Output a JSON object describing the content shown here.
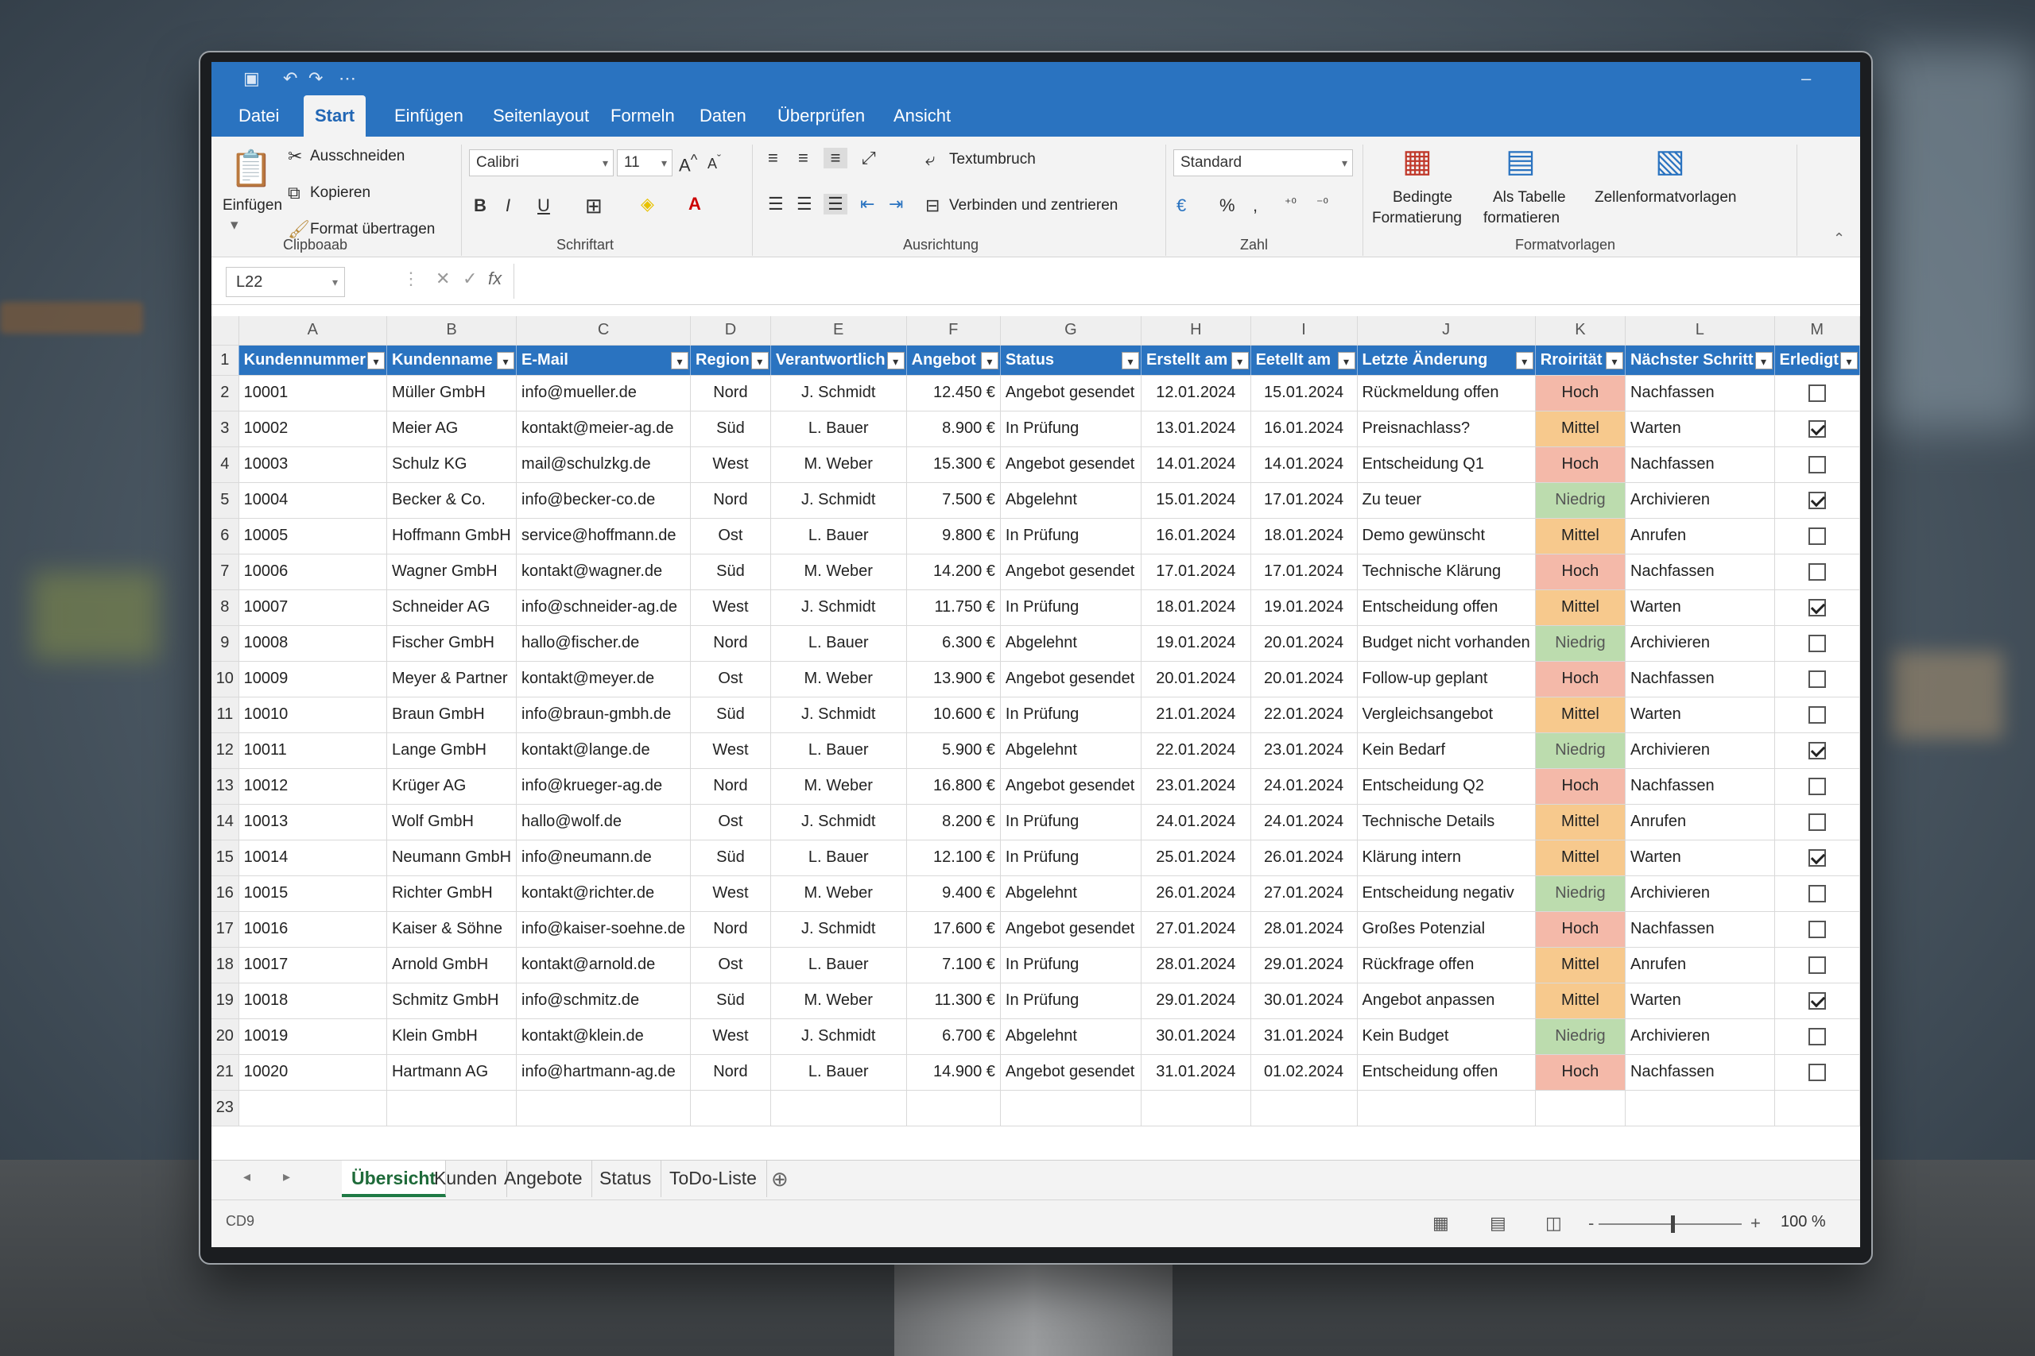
{
  "ribbon": {
    "tabs": [
      "Datei",
      "Start",
      "Einfügen",
      "Seitenlayout",
      "Formeln",
      "Daten",
      "Überprüfen",
      "Ansicht"
    ],
    "clipboard": {
      "paste": "Einfügen",
      "cut": "Ausschneiden",
      "copy": "Kopieren",
      "format_painter": "Format übertragen",
      "group": "Clipboaab"
    },
    "font": {
      "name": "Calibri",
      "size": "11",
      "group": "Schriftart",
      "bold": "B",
      "italic": "I",
      "underline": "U"
    },
    "alignment": {
      "wrap": "Textumbruch",
      "merge": "Verbinden und zentrieren",
      "group": "Ausrichtung"
    },
    "number": {
      "format": "Standard",
      "percent": "%",
      "group": "Zahl"
    },
    "styles": {
      "conditional_1": "Bedingte",
      "conditional_2": "Formatierung",
      "table_1": "Als Tabelle",
      "table_2": "formatieren",
      "cell_styles": "Zellenformatvorlagen",
      "group": "Formatvorlagen"
    }
  },
  "formula_bar": {
    "name_box": "L22",
    "fx": "fx",
    "value": ""
  },
  "columns": [
    "A",
    "B",
    "C",
    "D",
    "E",
    "F",
    "G",
    "H",
    "I",
    "J",
    "K",
    "L",
    "M"
  ],
  "headers": [
    "Kundennummer",
    "Kundenname",
    "E-Mail",
    "Region",
    "Verantwortlich",
    "Angebot",
    "Status",
    "Erstellt am",
    "Eetellt am",
    "Letzte Änderung",
    "Rroirität",
    "Nächster Schritt",
    "Erledigt"
  ],
  "rows": [
    {
      "n": "2",
      "id": "10001",
      "name": "Müller GmbH",
      "mail": "info@mueller.de",
      "region": "Nord",
      "owner": "J. Schmidt",
      "offer": "12.450 €",
      "status": "Angebot gesendet",
      "created": "12.01.2024",
      "edited": "15.01.2024",
      "change": "Rückmeldung offen",
      "prio": "Hoch",
      "next": "Nachfassen",
      "done": false
    },
    {
      "n": "3",
      "id": "10002",
      "name": "Meier AG",
      "mail": "kontakt@meier-ag.de",
      "region": "Süd",
      "owner": "L. Bauer",
      "offer": "8.900 €",
      "status": "In Prüfung",
      "created": "13.01.2024",
      "edited": "16.01.2024",
      "change": "Preisnachlass?",
      "prio": "Mittel",
      "next": "Warten",
      "done": true
    },
    {
      "n": "4",
      "id": "10003",
      "name": "Schulz KG",
      "mail": "mail@schulzkg.de",
      "region": "West",
      "owner": "M. Weber",
      "offer": "15.300 €",
      "status": "Angebot gesendet",
      "created": "14.01.2024",
      "edited": "14.01.2024",
      "change": "Entscheidung Q1",
      "prio": "Hoch",
      "next": "Nachfassen",
      "done": false
    },
    {
      "n": "5",
      "id": "10004",
      "name": "Becker & Co.",
      "mail": "info@becker-co.de",
      "region": "Nord",
      "owner": "J. Schmidt",
      "offer": "7.500 €",
      "status": "Abgelehnt",
      "created": "15.01.2024",
      "edited": "17.01.2024",
      "change": "Zu teuer",
      "prio": "Niedrig",
      "next": "Archivieren",
      "done": true
    },
    {
      "n": "6",
      "id": "10005",
      "name": "Hoffmann GmbH",
      "mail": "service@hoffmann.de",
      "region": "Ost",
      "owner": "L. Bauer",
      "offer": "9.800 €",
      "status": "In Prüfung",
      "created": "16.01.2024",
      "edited": "18.01.2024",
      "change": "Demo gewünscht",
      "prio": "Mittel",
      "next": "Anrufen",
      "done": false
    },
    {
      "n": "7",
      "id": "10006",
      "name": "Wagner GmbH",
      "mail": "kontakt@wagner.de",
      "region": "Süd",
      "owner": "M. Weber",
      "offer": "14.200 €",
      "status": "Angebot gesendet",
      "created": "17.01.2024",
      "edited": "17.01.2024",
      "change": "Technische Klärung",
      "prio": "Hoch",
      "next": "Nachfassen",
      "done": false
    },
    {
      "n": "8",
      "id": "10007",
      "name": "Schneider AG",
      "mail": "info@schneider-ag.de",
      "region": "West",
      "owner": "J. Schmidt",
      "offer": "11.750 €",
      "status": "In Prüfung",
      "created": "18.01.2024",
      "edited": "19.01.2024",
      "change": "Entscheidung offen",
      "prio": "Mittel",
      "next": "Warten",
      "done": true
    },
    {
      "n": "9",
      "id": "10008",
      "name": "Fischer GmbH",
      "mail": "hallo@fischer.de",
      "region": "Nord",
      "owner": "L. Bauer",
      "offer": "6.300 €",
      "status": "Abgelehnt",
      "created": "19.01.2024",
      "edited": "20.01.2024",
      "change": "Budget nicht vorhanden",
      "prio": "Niedrig",
      "next": "Archivieren",
      "done": false
    },
    {
      "n": "10",
      "id": "10009",
      "name": "Meyer & Partner",
      "mail": "kontakt@meyer.de",
      "region": "Ost",
      "owner": "M. Weber",
      "offer": "13.900 €",
      "status": "Angebot gesendet",
      "created": "20.01.2024",
      "edited": "20.01.2024",
      "change": "Follow-up geplant",
      "prio": "Hoch",
      "next": "Nachfassen",
      "done": false
    },
    {
      "n": "11",
      "id": "10010",
      "name": "Braun GmbH",
      "mail": "info@braun-gmbh.de",
      "region": "Süd",
      "owner": "J. Schmidt",
      "offer": "10.600 €",
      "status": "In Prüfung",
      "created": "21.01.2024",
      "edited": "22.01.2024",
      "change": "Vergleichsangebot",
      "prio": "Mittel",
      "next": "Warten",
      "done": false
    },
    {
      "n": "12",
      "id": "10011",
      "name": "Lange GmbH",
      "mail": "kontakt@lange.de",
      "region": "West",
      "owner": "L. Bauer",
      "offer": "5.900 €",
      "status": "Abgelehnt",
      "created": "22.01.2024",
      "edited": "23.01.2024",
      "change": "Kein Bedarf",
      "prio": "Niedrig",
      "next": "Archivieren",
      "done": true
    },
    {
      "n": "13",
      "id": "10012",
      "name": "Krüger AG",
      "mail": "info@krueger-ag.de",
      "region": "Nord",
      "owner": "M. Weber",
      "offer": "16.800 €",
      "status": "Angebot gesendet",
      "created": "23.01.2024",
      "edited": "24.01.2024",
      "change": "Entscheidung Q2",
      "prio": "Hoch",
      "next": "Nachfassen",
      "done": false
    },
    {
      "n": "14",
      "id": "10013",
      "name": "Wolf GmbH",
      "mail": "hallo@wolf.de",
      "region": "Ost",
      "owner": "J. Schmidt",
      "offer": "8.200 €",
      "status": "In Prüfung",
      "created": "24.01.2024",
      "edited": "24.01.2024",
      "change": "Technische Details",
      "prio": "Mittel",
      "next": "Anrufen",
      "done": false
    },
    {
      "n": "15",
      "id": "10014",
      "name": "Neumann GmbH",
      "mail": "info@neumann.de",
      "region": "Süd",
      "owner": "L. Bauer",
      "offer": "12.100 €",
      "status": "In Prüfung",
      "created": "25.01.2024",
      "edited": "26.01.2024",
      "change": "Klärung intern",
      "prio": "Mittel",
      "next": "Warten",
      "done": true
    },
    {
      "n": "16",
      "id": "10015",
      "name": "Richter GmbH",
      "mail": "kontakt@richter.de",
      "region": "West",
      "owner": "M. Weber",
      "offer": "9.400 €",
      "status": "Abgelehnt",
      "created": "26.01.2024",
      "edited": "27.01.2024",
      "change": "Entscheidung negativ",
      "prio": "Niedrig",
      "next": "Archivieren",
      "done": false
    },
    {
      "n": "17",
      "id": "10016",
      "name": "Kaiser & Söhne",
      "mail": "info@kaiser-soehne.de",
      "region": "Nord",
      "owner": "J. Schmidt",
      "offer": "17.600 €",
      "status": "Angebot gesendet",
      "created": "27.01.2024",
      "edited": "28.01.2024",
      "change": "Großes Potenzial",
      "prio": "Hoch",
      "next": "Nachfassen",
      "done": false
    },
    {
      "n": "18",
      "id": "10017",
      "name": "Arnold GmbH",
      "mail": "kontakt@arnold.de",
      "region": "Ost",
      "owner": "L. Bauer",
      "offer": "7.100 €",
      "status": "In Prüfung",
      "created": "28.01.2024",
      "edited": "29.01.2024",
      "change": "Rückfrage offen",
      "prio": "Mittel",
      "next": "Anrufen",
      "done": false
    },
    {
      "n": "19",
      "id": "10018",
      "name": "Schmitz GmbH",
      "mail": "info@schmitz.de",
      "region": "Süd",
      "owner": "M. Weber",
      "offer": "11.300 €",
      "status": "In Prüfung",
      "created": "29.01.2024",
      "edited": "30.01.2024",
      "change": "Angebot anpassen",
      "prio": "Mittel",
      "next": "Warten",
      "done": true
    },
    {
      "n": "20",
      "id": "10019",
      "name": "Klein GmbH",
      "mail": "kontakt@klein.de",
      "region": "West",
      "owner": "J. Schmidt",
      "offer": "6.700 €",
      "status": "Abgelehnt",
      "created": "30.01.2024",
      "edited": "31.01.2024",
      "change": "Kein Budget",
      "prio": "Niedrig",
      "next": "Archivieren",
      "done": false
    },
    {
      "n": "21",
      "id": "10020",
      "name": "Hartmann AG",
      "mail": "info@hartmann-ag.de",
      "region": "Nord",
      "owner": "L. Bauer",
      "offer": "14.900 €",
      "status": "Angebot gesendet",
      "created": "31.01.2024",
      "edited": "01.02.2024",
      "change": "Entscheidung offen",
      "prio": "Hoch",
      "next": "Nachfassen",
      "done": false
    }
  ],
  "empty_row": "23",
  "sheet_tabs": [
    "Übersicht",
    "Kunden",
    "Angebote",
    "Status",
    "ToDo-Liste"
  ],
  "status_bar": {
    "mode": "CD9",
    "zoom": "100 %",
    "minus": "-",
    "plus": "+"
  },
  "colors": {
    "accent": "#2a73c0",
    "prio_hoch": "#f4b9a9",
    "prio_mittel": "#f7c98d",
    "prio_niedrig": "#bcdcae"
  }
}
